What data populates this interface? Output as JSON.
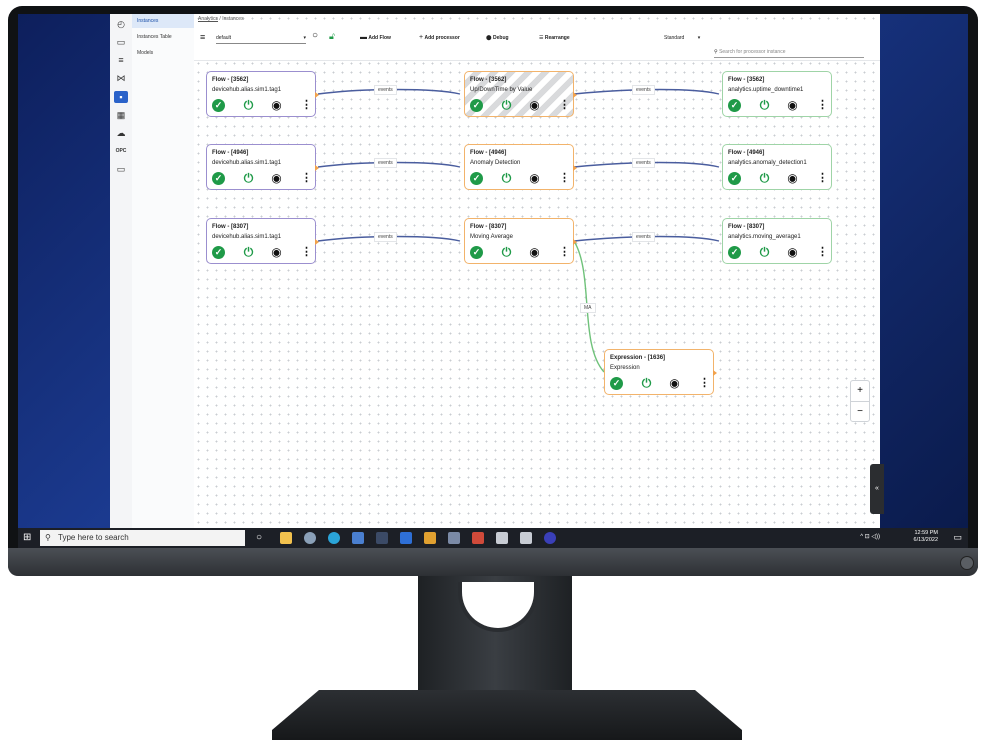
{
  "breadcrumb": {
    "root": "Analytics",
    "sep": "/",
    "current": "Instances"
  },
  "subnav": {
    "items": [
      "Instances",
      "Instances Table",
      "Models"
    ]
  },
  "toolbar": {
    "flow_select": "default",
    "add_flow": "Add Flow",
    "add_processor": "Add processor",
    "debug": "Debug",
    "rearrange": "Rearrange",
    "view_mode": "Standard",
    "search_placeholder": "Search for processor instance"
  },
  "rows": [
    {
      "source": {
        "title": "Flow - [3562]",
        "subtitle": "devicehub.alias.sim1.tag1"
      },
      "edge1_label": "events",
      "processor": {
        "title": "Flow - [3562]",
        "subtitle": "Up/DownTime by Value"
      },
      "edge2_label": "events",
      "target": {
        "title": "Flow - [3562]",
        "subtitle": "analytics.uptime_downtime1"
      }
    },
    {
      "source": {
        "title": "Flow - [4946]",
        "subtitle": "devicehub.alias.sim1.tag1"
      },
      "edge1_label": "events",
      "processor": {
        "title": "Flow - [4946]",
        "subtitle": "Anomaly Detection"
      },
      "edge2_label": "events",
      "target": {
        "title": "Flow - [4946]",
        "subtitle": "analytics.anomaly_detection1"
      }
    },
    {
      "source": {
        "title": "Flow - [8307]",
        "subtitle": "devicehub.alias.sim1.tag1"
      },
      "edge1_label": "events",
      "processor": {
        "title": "Flow - [8307]",
        "subtitle": "Moving Average"
      },
      "edge2_label": "events",
      "target": {
        "title": "Flow - [8307]",
        "subtitle": "analytics.moving_average1"
      }
    }
  ],
  "expression": {
    "title": "Expression - [1636]",
    "subtitle": "Expression",
    "edge_label": "MA"
  },
  "zoom": {
    "in": "+",
    "out": "−"
  },
  "taskbar": {
    "search_placeholder": "Type here to search",
    "time": "12:59 PM",
    "date": "6/13/2022"
  },
  "colors": {
    "flow_source_border": "#9b8fcf",
    "processor_border": "#f2b36b",
    "flow_target_border": "#9fd4a7",
    "status_ok": "#1f9a48",
    "edge": "#4a5d9e",
    "edge_expr": "#6fc27a"
  },
  "icons": {
    "status": "check-circle-icon",
    "power": "power-icon",
    "view": "eye-icon",
    "menu": "more-vertical-icon"
  }
}
